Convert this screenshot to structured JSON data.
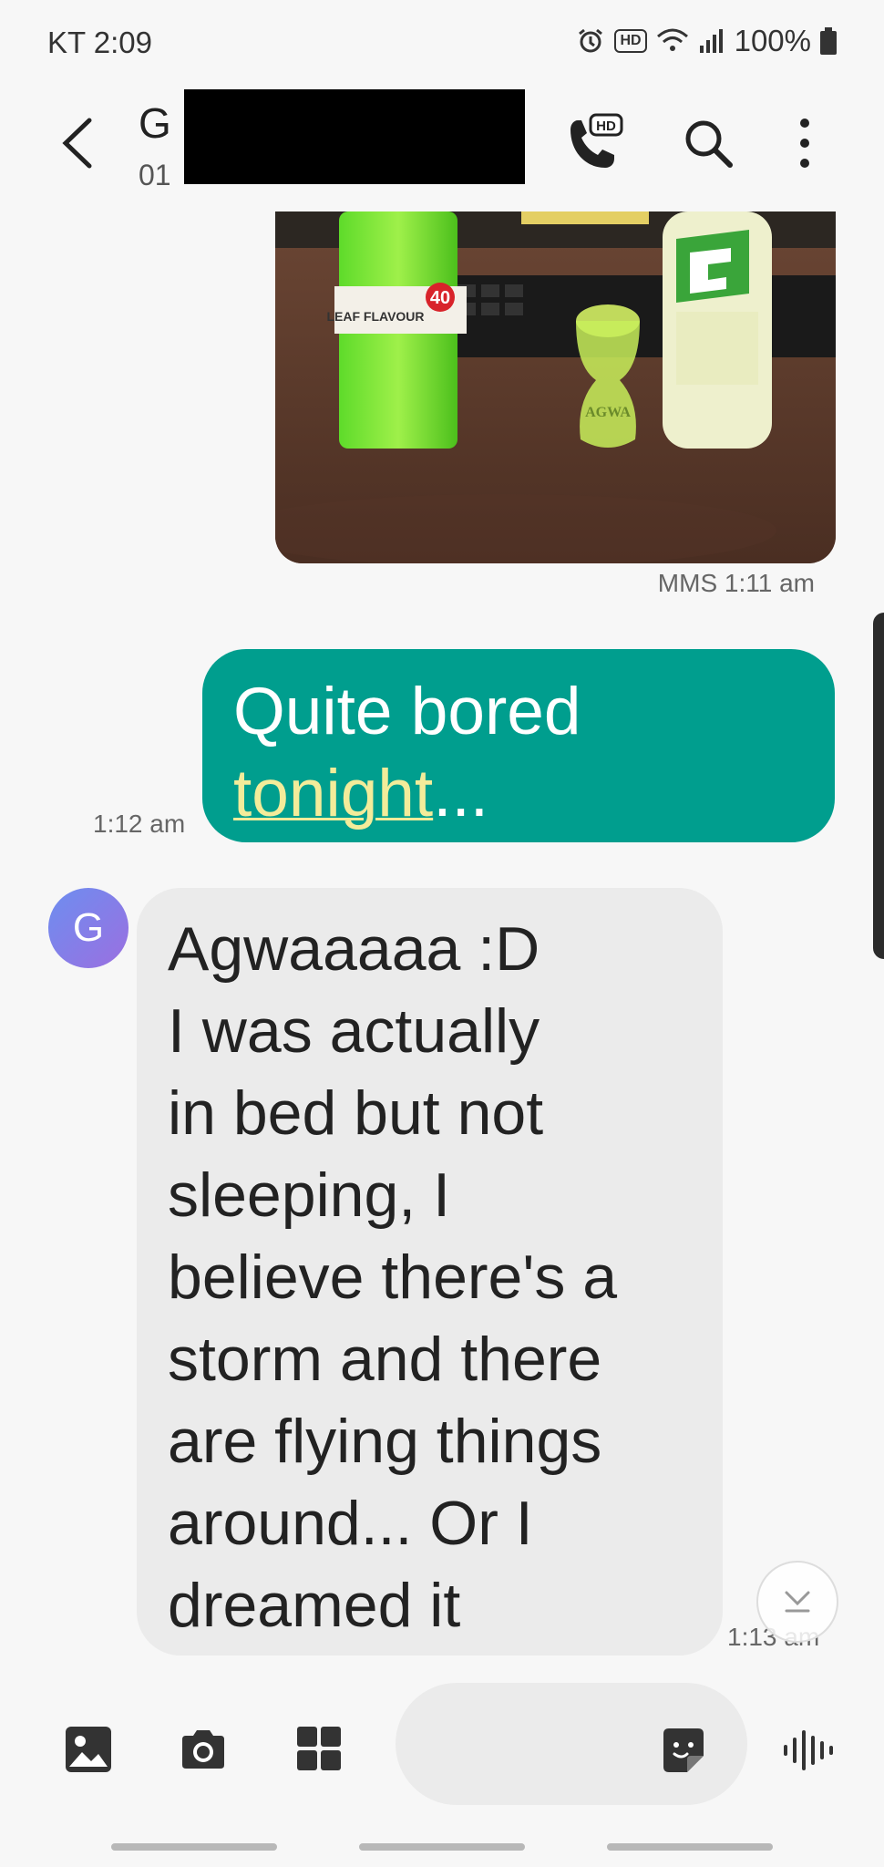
{
  "status_bar": {
    "carrier_time": "KT 2:09",
    "battery": "100%",
    "hd_badge": "HD"
  },
  "header": {
    "contact_name": "G",
    "contact_number": "01",
    "call_hd_badge": "HD"
  },
  "messages": {
    "photo_label_bottle": "40",
    "photo_label_text": "LEAF FLAVOUR",
    "photo_label_glass": "AGWA",
    "photo_time": "MMS 1:11 am",
    "sent_text_part1": "Quite bored",
    "sent_link": "tonight",
    "sent_suffix": "...",
    "sent_time": "1:12 am",
    "received_avatar_letter": "G",
    "received_text": "Agwaaaaa :D\nI was actually\nin bed but not\nsleeping, I\nbelieve there's a\nstorm and there\nare flying things\naround... Or I\ndreamed it",
    "received_time": "1:13 am"
  },
  "colors": {
    "sent_bubble": "#009e8e",
    "received_bubble": "#ebebeb",
    "link_highlight": "#f3ec9a",
    "avatar_gradient_start": "#6d8ef0",
    "avatar_gradient_end": "#9b6fe0"
  },
  "icons": {
    "back": "chevron-left-icon",
    "call": "phone-hd-icon",
    "search": "search-icon",
    "more": "more-vertical-icon",
    "gallery": "image-icon",
    "camera": "camera-icon",
    "apps": "grid-icon",
    "sticker": "sticker-icon",
    "voice": "voice-wave-icon",
    "scroll": "chevron-down-icon"
  }
}
